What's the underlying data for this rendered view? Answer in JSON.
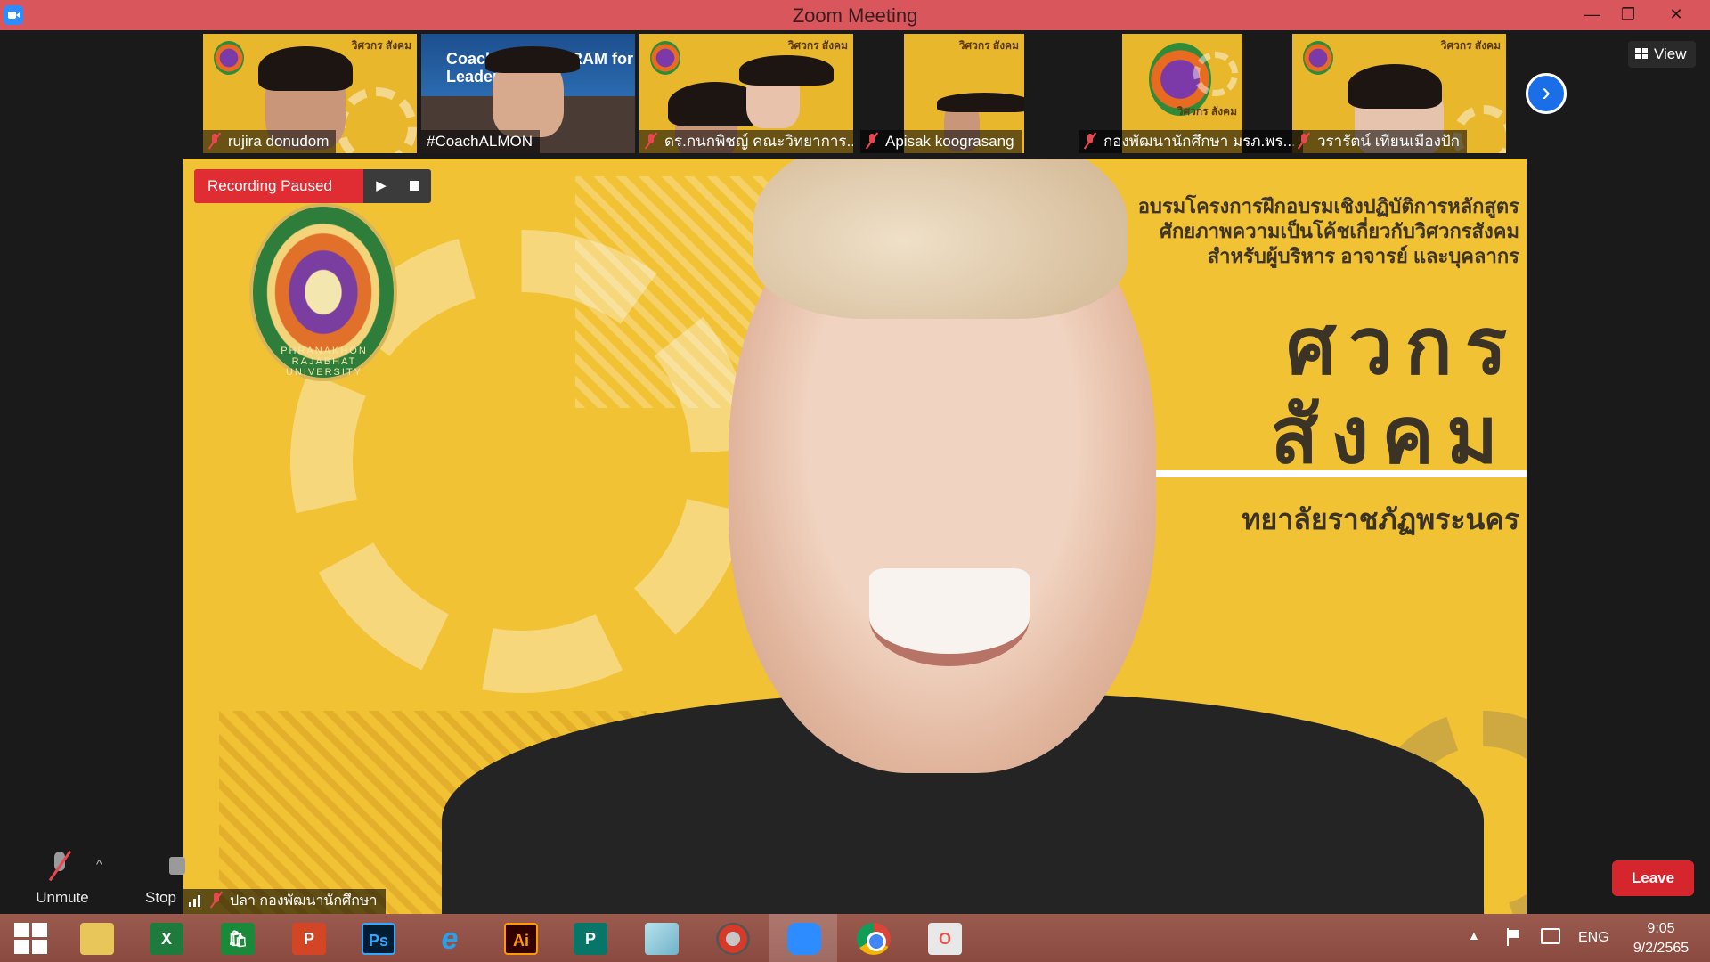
{
  "window": {
    "title": "Zoom Meeting",
    "minimize": "—",
    "maximize": "❐",
    "close": "✕"
  },
  "thumbnails": [
    {
      "name": "rujira donudom",
      "muted": true,
      "poster": "วิศวกร สังคม"
    },
    {
      "name": "#CoachALMON",
      "muted": false,
      "board": "Coaching PROGRAM for Leader"
    },
    {
      "name": "ดร.กนกพิชญ์ คณะวิทยาการ...",
      "muted": true,
      "poster": "วิศวกร สังคม"
    },
    {
      "name": "Apisak koograsang",
      "muted": true,
      "poster": "วิศวกร สังคม"
    },
    {
      "name": "กองพัฒนานักศึกษา มรภ.พร...",
      "muted": true,
      "poster": "วิศวกร สังคม"
    },
    {
      "name": "วรารัตน์ เทียนเมืองปัก",
      "muted": true,
      "poster": "วิศวกร สังคม"
    }
  ],
  "next_arrow": "›",
  "view_button": "View",
  "recording": {
    "status": "Recording Paused",
    "play": "▶"
  },
  "speaker": {
    "name": "ปลา กองพัฒนานักศึกษา",
    "seal_caption": "PHRANAKHON RAJABHAT UNIVERSITY",
    "poster_lines": [
      "อบรมโครงการฝึกอบรมเชิงปฏิบัติการหลักสูตร",
      "ศักยภาพความเป็นโค้ชเกี่ยวกับวิศวกรสังคม",
      "สำหรับผู้บริหาร อาจารย์ และบุคลากร"
    ],
    "poster_big1": "ศวกร",
    "poster_big2": "สังคม",
    "poster_uni": "ทยาลัยราชภัฏพระนคร"
  },
  "controls": {
    "unmute": "Unmute",
    "caret": "^",
    "stop": "Stop",
    "leave": "Leave"
  },
  "taskbar": {
    "excel": "X",
    "store": "🛍",
    "powerpoint": "P",
    "photoshop": "Ps",
    "ie": "e",
    "illustrator": "Ai",
    "publisher": "P",
    "office": "O",
    "tray_caret": "▲",
    "language": "ENG",
    "time": "9:05",
    "date": "9/2/2565"
  },
  "colors": {
    "title_bar": "#d9565c",
    "recording": "#e02d33",
    "leave": "#d4262c",
    "zoom_blue": "#2d8cff"
  }
}
